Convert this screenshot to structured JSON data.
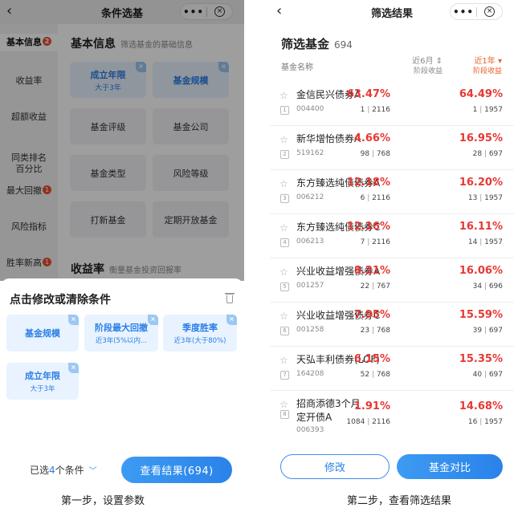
{
  "step1": {
    "nav": {
      "back_icon": "chevron-left-icon",
      "title": "条件选基",
      "more": "•••",
      "close_icon": "close-circle-icon"
    },
    "sidebar": [
      {
        "label": "基本信息",
        "badge": "2"
      },
      {
        "label": "收益率",
        "badge": null
      },
      {
        "label": "超额收益",
        "badge": null
      },
      {
        "label": "同类排名\n百分比",
        "badge": null
      },
      {
        "label": "最大回撤",
        "badge": "1"
      },
      {
        "label": "风险指标",
        "badge": null
      },
      {
        "label": "胜率新高",
        "badge": "1"
      }
    ],
    "basic": {
      "title": "基本信息",
      "subtitle": "筛选基金的基础信息",
      "chips": [
        {
          "label": "成立年限",
          "sub": "大于3年",
          "selected": true
        },
        {
          "label": "基金规模",
          "sub": "",
          "selected": true
        },
        {
          "label": "基金评级",
          "sub": "",
          "selected": false
        },
        {
          "label": "基金公司",
          "sub": "",
          "selected": false
        },
        {
          "label": "基金类型",
          "sub": "",
          "selected": false
        },
        {
          "label": "风险等级",
          "sub": "",
          "selected": false
        },
        {
          "label": "打新基金",
          "sub": "",
          "selected": false
        },
        {
          "label": "定期开放基金",
          "sub": "",
          "selected": false
        }
      ]
    },
    "returns": {
      "title": "收益率",
      "subtitle": "衡量基金投资回报率"
    },
    "sheet": {
      "title": "点击修改或清除条件",
      "trash_icon": "trash-icon",
      "conditions": [
        {
          "label": "基金规模",
          "sub": ""
        },
        {
          "label": "阶段最大回撤",
          "sub": "近3年(5%以内..."
        },
        {
          "label": "季度胜率",
          "sub": "近3年(大于80%)"
        },
        {
          "label": "成立年限",
          "sub": "大于3年"
        }
      ],
      "selected_prefix": "已选",
      "selected_num": "4",
      "selected_suffix": "个条件",
      "view_button": "查看结果(694)"
    },
    "caption": "第一步，设置参数"
  },
  "step2": {
    "nav": {
      "back_icon": "chevron-left-icon",
      "title": "筛选结果",
      "more": "•••",
      "close_icon": "close-circle-icon"
    },
    "title": "筛选基金",
    "count": "694",
    "col_name": "基金名称",
    "col_6m": {
      "label": "近6月 ⇕",
      "sub": "阶段收益"
    },
    "col_1y": {
      "label": "近1年 ▾",
      "sub": "阶段收益"
    },
    "funds": [
      {
        "rank": "1",
        "name": "金信民兴债券A",
        "code": "004400",
        "r6m": "63.47%",
        "rank6m": "1",
        "total6m": "2116",
        "r1y": "64.49%",
        "rank1y": "1",
        "total1y": "1957"
      },
      {
        "rank": "2",
        "name": "新华增怡债券A",
        "code": "519162",
        "r6m": "4.66%",
        "rank6m": "98",
        "total6m": "768",
        "r1y": "16.95%",
        "rank1y": "28",
        "total1y": "697"
      },
      {
        "rank": "3",
        "name": "东方臻选纯债债券A",
        "code": "006212",
        "r6m": "12.18%",
        "rank6m": "6",
        "total6m": "2116",
        "r1y": "16.20%",
        "rank1y": "13",
        "total1y": "1957"
      },
      {
        "rank": "4",
        "name": "东方臻选纯债债券C",
        "code": "006213",
        "r6m": "12.16%",
        "rank6m": "7",
        "total6m": "2116",
        "r1y": "16.11%",
        "rank1y": "14",
        "total1y": "1957"
      },
      {
        "rank": "5",
        "name": "兴业收益增强债券A",
        "code": "001257",
        "r6m": "8.21%",
        "rank6m": "22",
        "total6m": "767",
        "r1y": "16.06%",
        "rank1y": "34",
        "total1y": "696"
      },
      {
        "rank": "6",
        "name": "兴业收益增强债券C",
        "code": "001258",
        "r6m": "7.95%",
        "rank6m": "23",
        "total6m": "768",
        "r1y": "15.59%",
        "rank1y": "39",
        "total1y": "697"
      },
      {
        "rank": "7",
        "name": "天弘丰利债券(LOF)",
        "code": "164208",
        "r6m": "6.15%",
        "rank6m": "52",
        "total6m": "768",
        "r1y": "15.35%",
        "rank1y": "40",
        "total1y": "697"
      },
      {
        "rank": "8",
        "name": "招商添德3个月定开债A",
        "code": "006393",
        "r6m": "1.91%",
        "rank6m": "1084",
        "total6m": "2116",
        "r1y": "14.68%",
        "rank1y": "16",
        "total1y": "1957"
      }
    ],
    "modify_button": "修改",
    "compare_button": "基金对比",
    "caption": "第二步，查看筛选结果"
  }
}
